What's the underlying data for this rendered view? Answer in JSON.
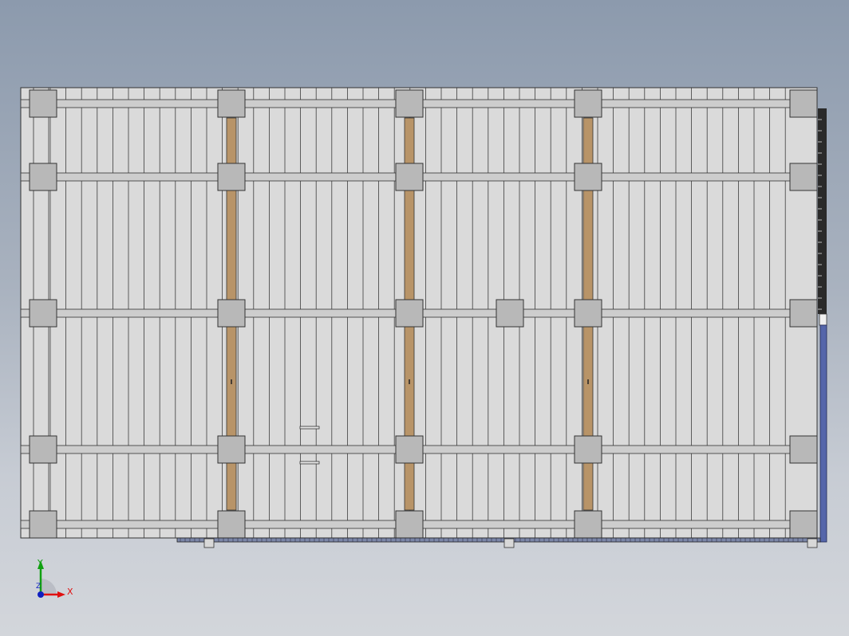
{
  "viewport": {
    "background_top": "#8c9aad",
    "background_bottom": "#d3d6db"
  },
  "model": {
    "colors": {
      "deck_fill": "#dadada",
      "outline": "#333333",
      "plank_line": "#3c3c3c",
      "beam_fill": "#cdcdcd",
      "column_fill": "#b8b8b8",
      "joist_fill": "#b89468",
      "rail_fill": "#2a2a2a"
    },
    "grid": {
      "column_rows": 5,
      "column_cols": 5,
      "extra_center_column": true,
      "orange_joists": 3
    }
  },
  "triad": {
    "x_label": "X",
    "y_label": "Y",
    "z_label": "Z",
    "x_color": "#e01010",
    "y_color": "#10a010",
    "z_color": "#1020c0",
    "icon": "coordinate-triad-icon"
  }
}
